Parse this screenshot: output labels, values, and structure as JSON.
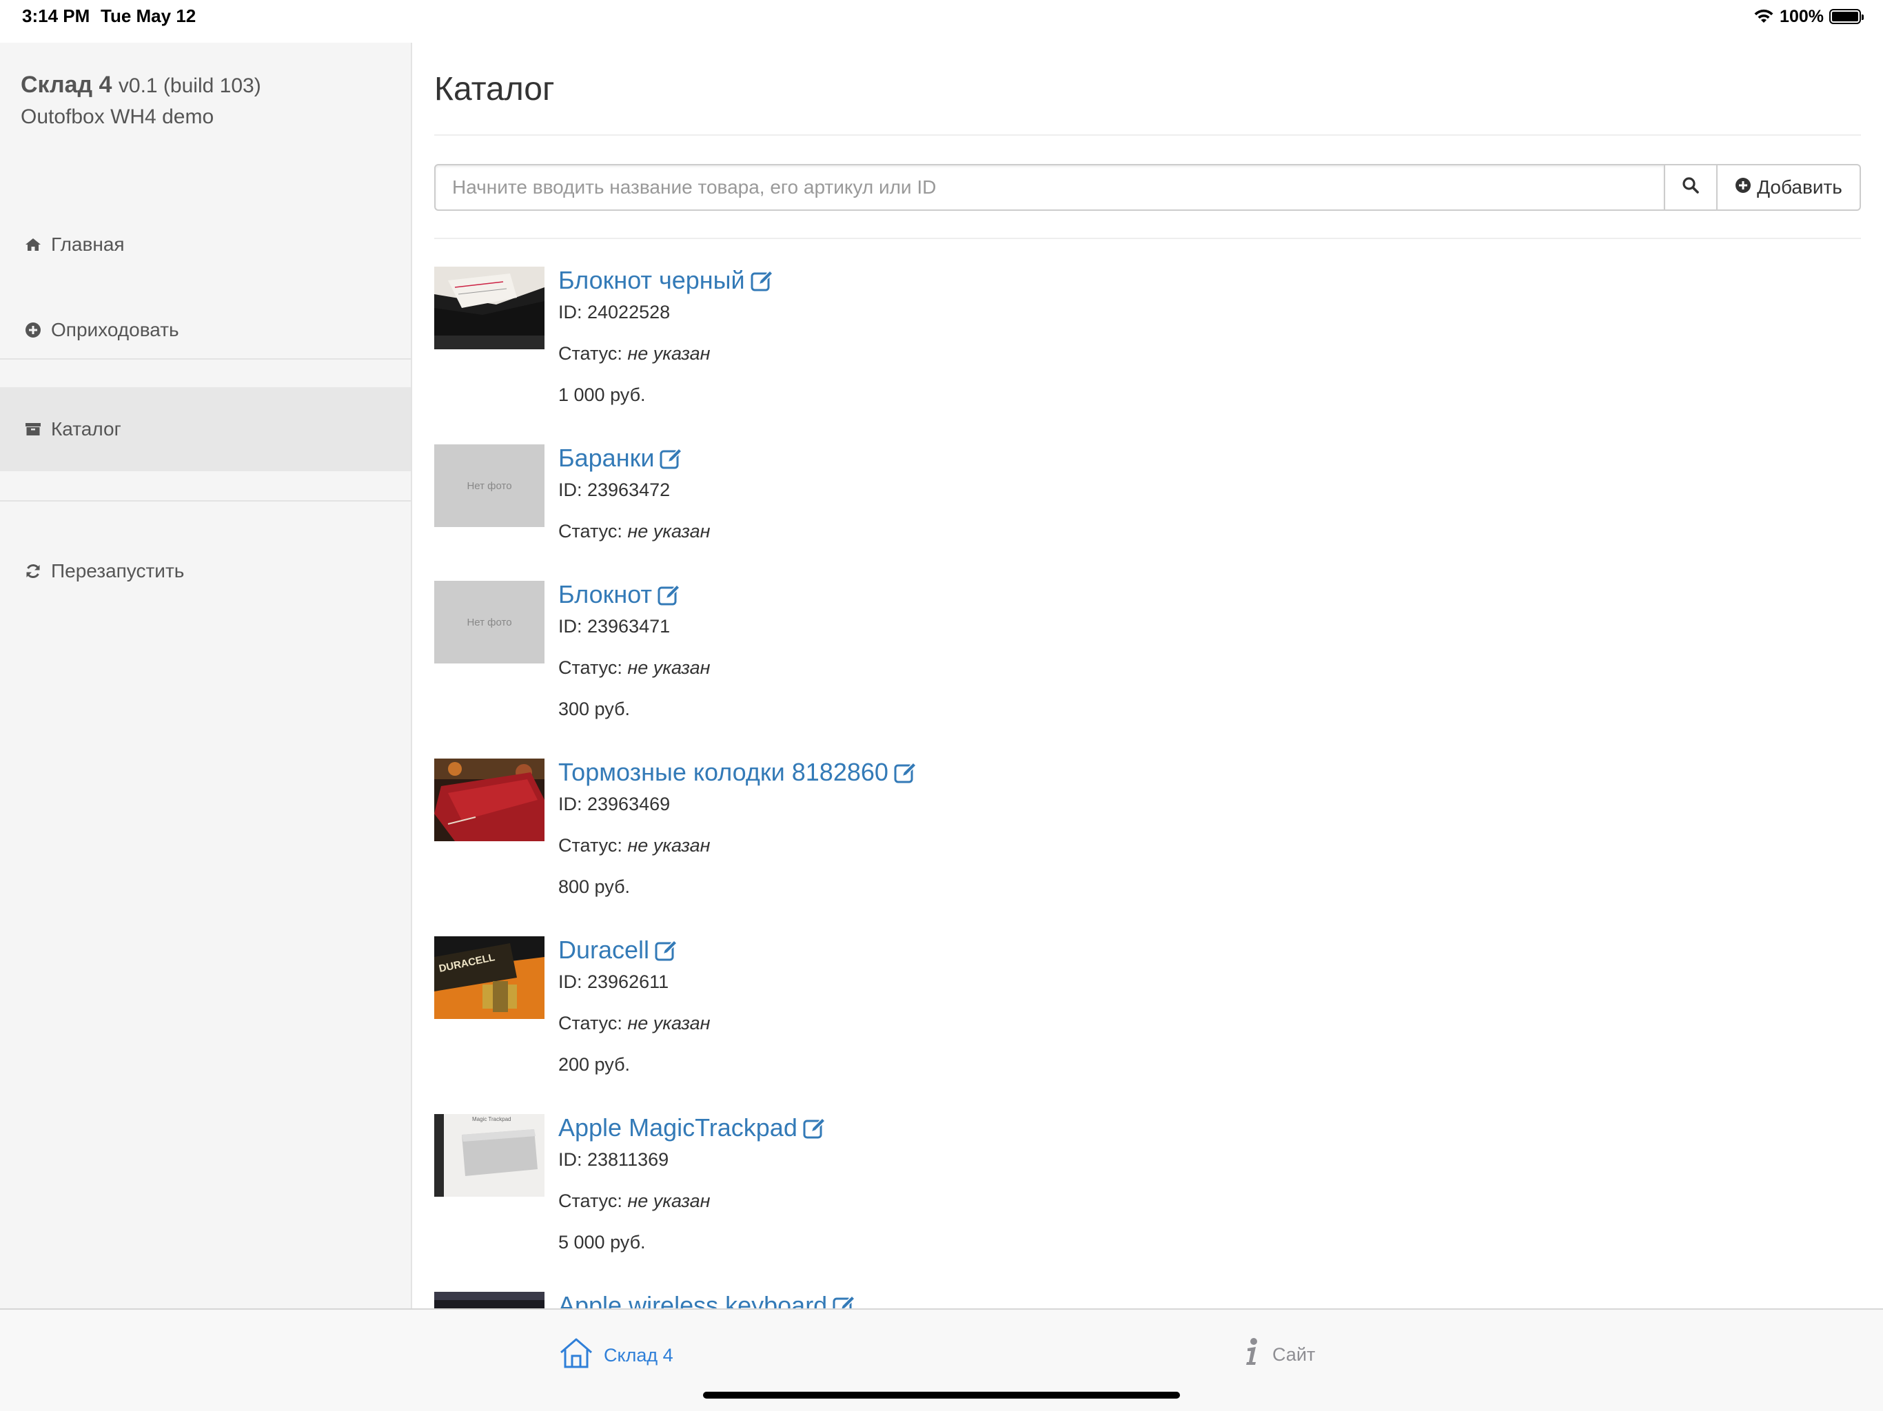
{
  "status_bar": {
    "time": "3:14 PM",
    "date": "Tue May 12",
    "battery_percent": "100%",
    "battery_level": 1.0,
    "icons": [
      "wifi-icon",
      "battery-icon"
    ]
  },
  "sidebar": {
    "app_name": "Склад 4",
    "version": "v0.1 (build 103)",
    "account": "Outofbox WH4 demo",
    "items": [
      {
        "label": "Главная",
        "icon": "home-icon",
        "active": false
      },
      {
        "label": "Оприходовать",
        "icon": "plus-circle-icon",
        "active": false
      },
      {
        "label": "Каталог",
        "icon": "archive-icon",
        "active": true
      },
      {
        "label": "Перезапустить",
        "icon": "refresh-icon",
        "active": false
      }
    ]
  },
  "main": {
    "title": "Каталог",
    "search": {
      "placeholder": "Начните вводить название товара, его артикул или ID",
      "value": ""
    },
    "add_button": "Добавить",
    "products": [
      {
        "name": "Блокнот черный",
        "id": "ID: 24022528",
        "status_label": "Статус:",
        "status": "не указан",
        "price": "1 000 руб.",
        "thumb": "photo-notebook"
      },
      {
        "name": "Баранки",
        "id": "ID: 23963472",
        "status_label": "Статус:",
        "status": "не указан",
        "price": "",
        "thumb": "no-photo"
      },
      {
        "name": "Блокнот",
        "id": "ID: 23963471",
        "status_label": "Статус:",
        "status": "не указан",
        "price": "300 руб.",
        "thumb": "no-photo"
      },
      {
        "name": "Тормозные колодки 8182860",
        "id": "ID: 23963469",
        "status_label": "Статус:",
        "status": "не указан",
        "price": "800 руб.",
        "thumb": "photo-red-box"
      },
      {
        "name": "Duracell",
        "id": "ID: 23962611",
        "status_label": "Статус:",
        "status": "не указан",
        "price": "200 руб.",
        "thumb": "photo-duracell"
      },
      {
        "name": "Apple MagicTrackpad",
        "id": "ID: 23811369",
        "status_label": "Статус:",
        "status": "не указан",
        "price": "5 000 руб.",
        "thumb": "photo-trackpad"
      },
      {
        "name": "Apple wireless keyboard",
        "id": "",
        "status_label": "",
        "status": "",
        "price": "",
        "thumb": "photo-keyboard"
      }
    ],
    "no_photo_text": "Нет фото",
    "duracell_box_text": "DURACELL",
    "trackpad_box_text": "Magic Trackpad"
  },
  "tabbar": {
    "tabs": [
      {
        "label": "Склад 4",
        "icon": "home-outline-icon",
        "active": true
      },
      {
        "label": "Сайт",
        "icon": "info-icon",
        "active": false
      }
    ]
  },
  "colors": {
    "link": "#337ab7",
    "tab_active": "#2f7fd8",
    "sidebar_bg": "#f5f5f5",
    "sidebar_active_bg": "#e7e7e7"
  }
}
